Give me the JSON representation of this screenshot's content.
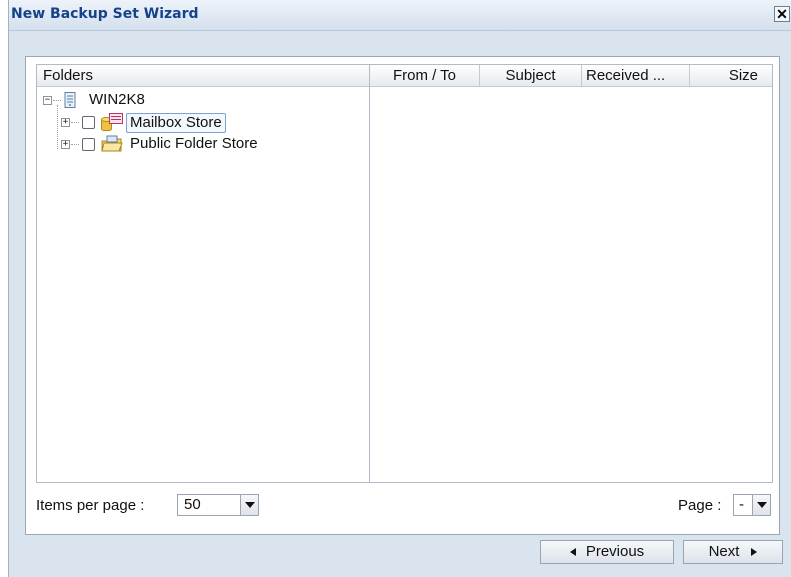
{
  "window": {
    "title": "New Backup Set Wizard",
    "close_label": "✕"
  },
  "tree": {
    "header": "Folders",
    "root": {
      "label": "WIN2K8",
      "expander": "−",
      "icon": "server-icon"
    },
    "children": [
      {
        "label": "Mailbox Store",
        "expander": "+",
        "checked": false,
        "icon": "mailbox-store-icon",
        "selected": true
      },
      {
        "label": "Public Folder Store",
        "expander": "+",
        "checked": false,
        "icon": "public-folder-store-icon",
        "selected": false
      }
    ]
  },
  "grid": {
    "columns": [
      {
        "label": "From / To"
      },
      {
        "label": "Subject"
      },
      {
        "label": "Received ..."
      },
      {
        "label": "Size"
      }
    ]
  },
  "pager": {
    "items_per_page_label": "Items per page :",
    "items_per_page_value": "50",
    "page_label": "Page :",
    "page_value": "-"
  },
  "buttons": {
    "previous_label": "Previous",
    "next_label": "Next"
  },
  "colors": {
    "title_text": "#15428b",
    "window_bg": "#dae4ef"
  }
}
